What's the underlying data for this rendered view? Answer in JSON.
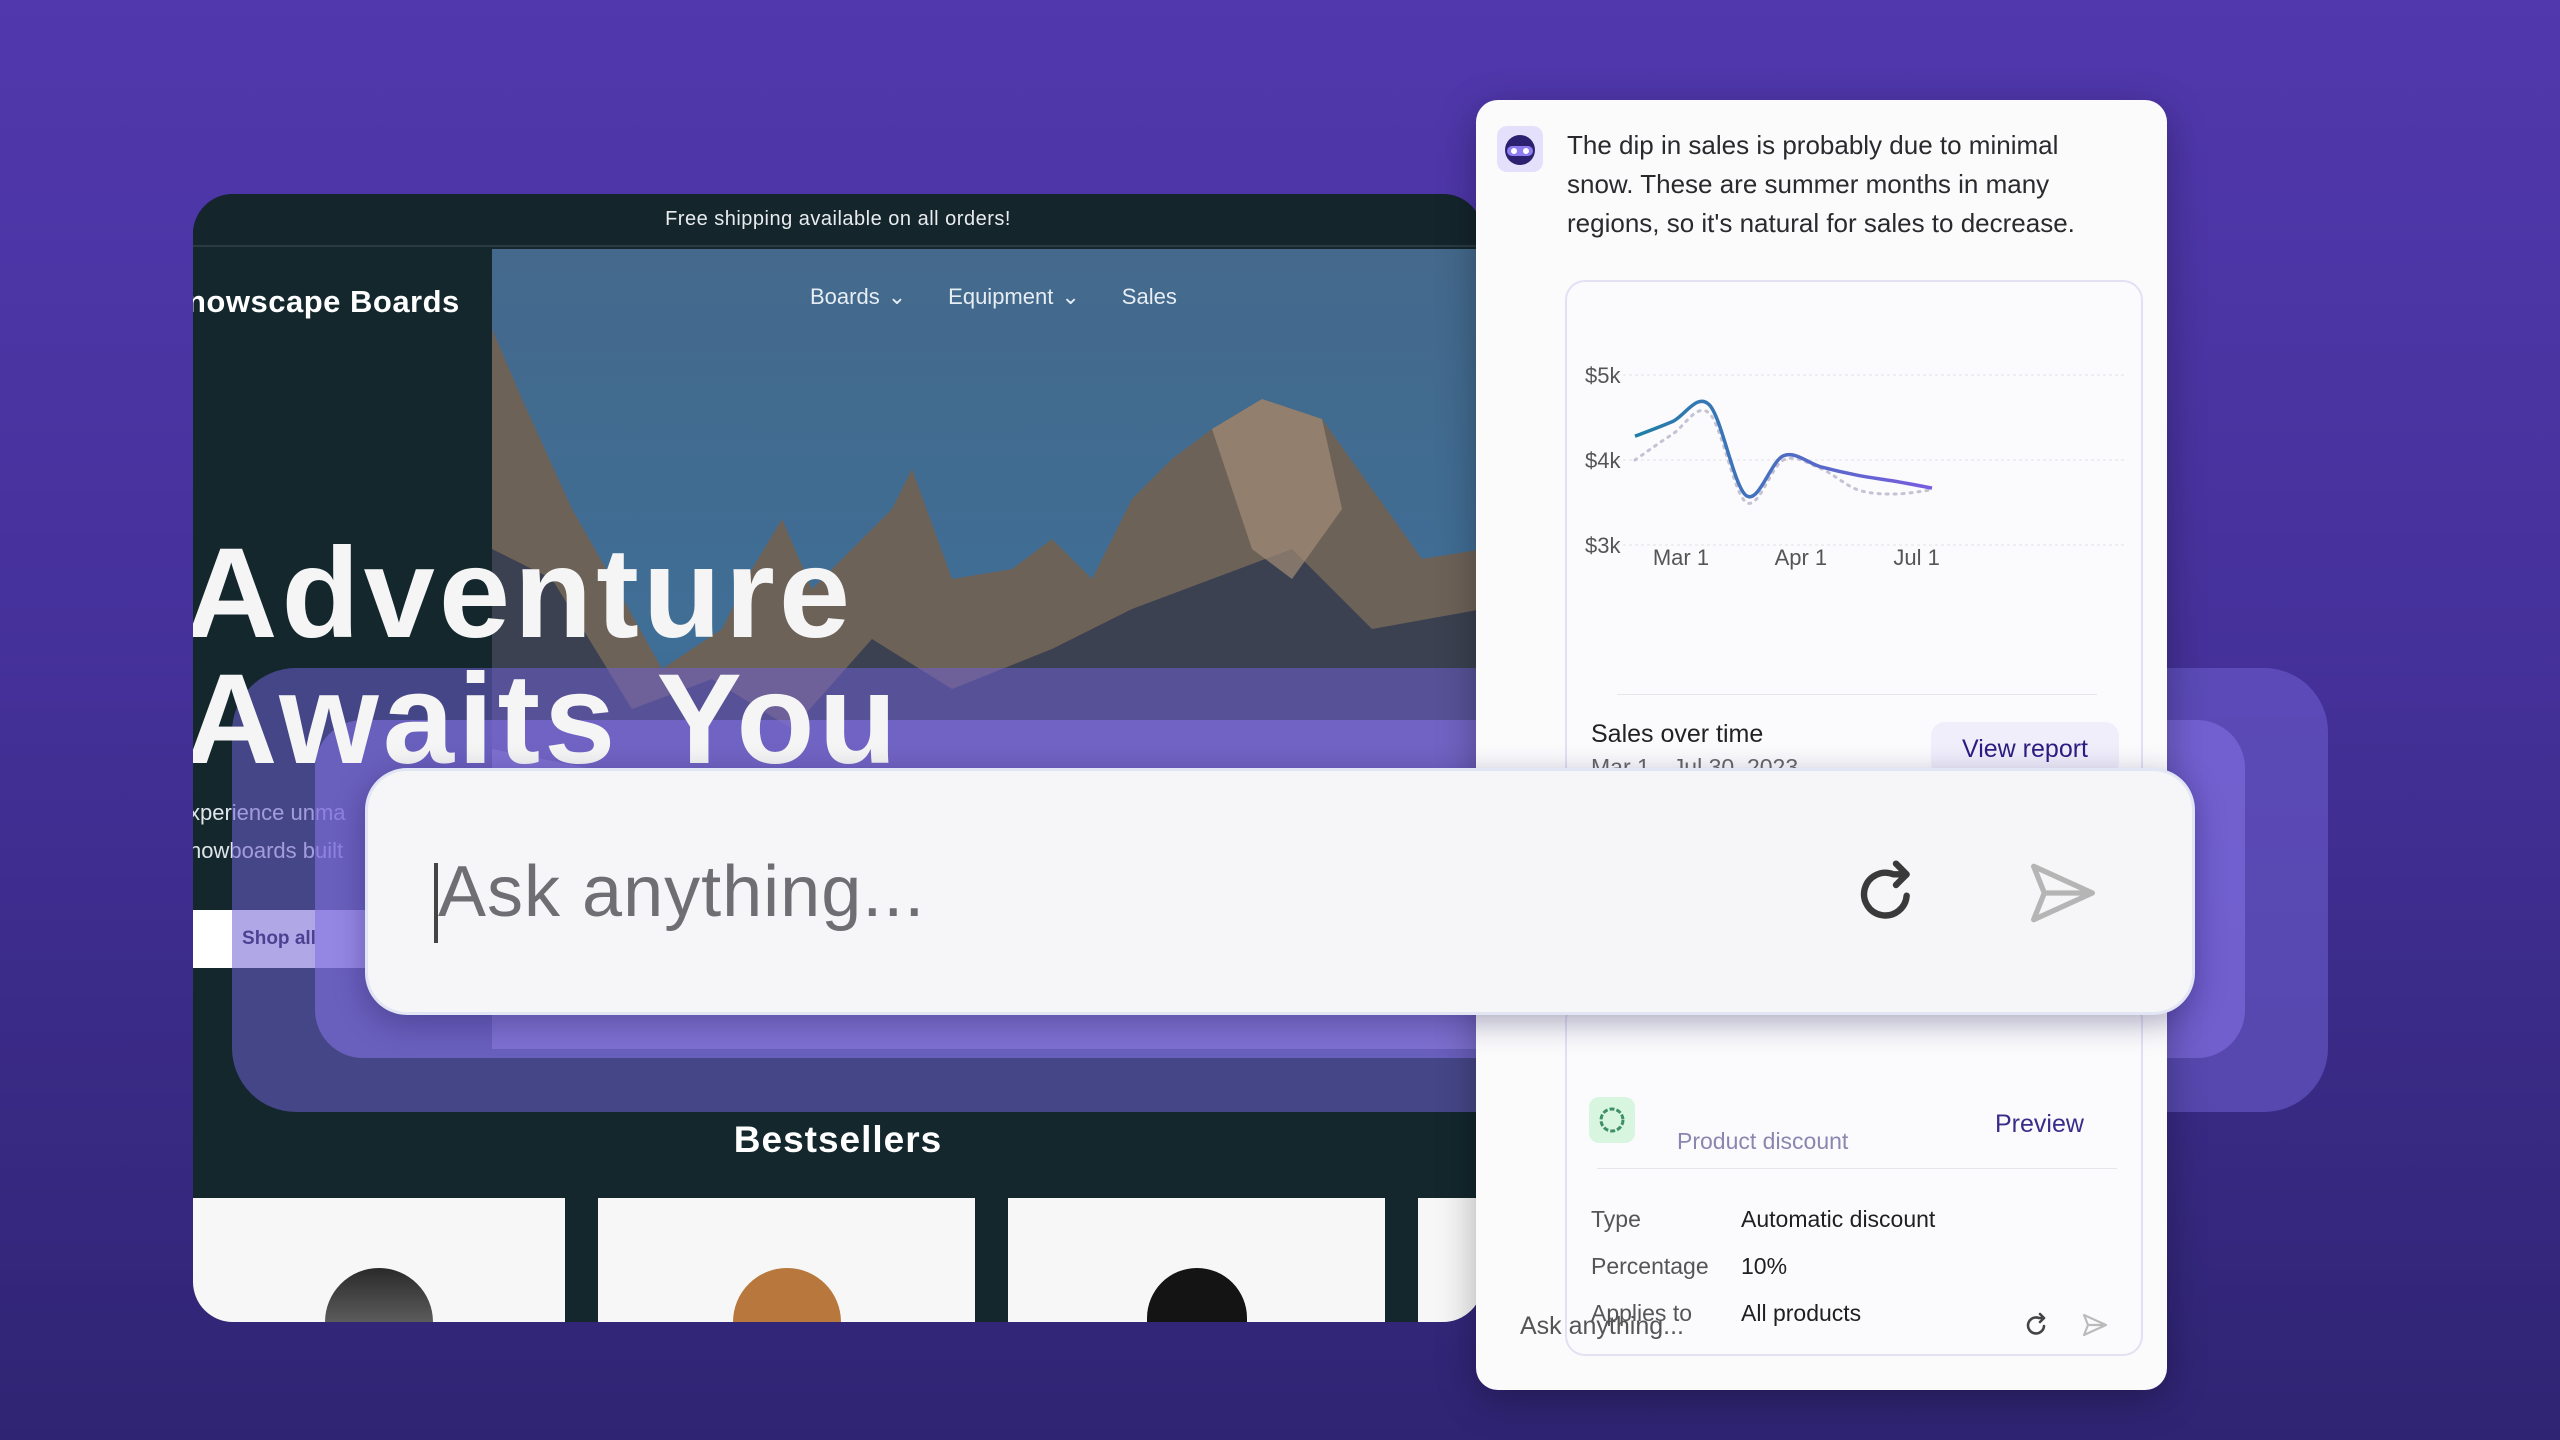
{
  "store": {
    "announcement": "Free shipping available on all orders!",
    "logo": "nowscape Boards",
    "nav": [
      {
        "label": "Boards",
        "icon": "chevron-down-icon"
      },
      {
        "label": "Equipment",
        "icon": "chevron-down-icon"
      },
      {
        "label": "Sales"
      }
    ],
    "headline_line1": "Adventure",
    "headline_line2": "Awaits You",
    "subtext_line1": "xperience unma",
    "subtext_line2": "nowboards built",
    "shop_button": "Shop all",
    "bestsellers_title": "Bestsellers",
    "product_colors": [
      "#4a4a4a",
      "#b8773c",
      "#141414"
    ]
  },
  "big_input": {
    "placeholder": "Ask anything...",
    "refresh_icon": "refresh-icon",
    "send_icon": "send-icon"
  },
  "assistant": {
    "avatar_icon": "robot-avatar-icon",
    "message": "The dip in sales is probably due to minimal snow. These are summer months in many regions, so it's natural for sales to decrease.",
    "chart_card": {
      "title": "Sales over time",
      "date_range": "Mar 1—Jul 30, 2023",
      "button": "View report"
    },
    "discount_card": {
      "icon": "discount-badge-icon",
      "subtitle": "Product discount",
      "preview_link": "Preview",
      "rows": [
        {
          "label": "Type",
          "value": "Automatic discount"
        },
        {
          "label": "Percentage",
          "value": "10%"
        },
        {
          "label": "Applies to",
          "value": "All products"
        }
      ]
    },
    "input_placeholder": "Ask anything..."
  },
  "colors": {
    "accent": "#2c1d82",
    "line_start": "#1f7fa6",
    "line_end": "#7a5ce0",
    "background": "#4a34a8"
  },
  "chart_data": {
    "type": "line",
    "title": "Sales over time",
    "x_ticks": [
      "Mar 1",
      "Apr 1",
      "Jul 1"
    ],
    "y_ticks": [
      "$3k",
      "$4k",
      "$5k"
    ],
    "ylim": [
      3000,
      5000
    ],
    "grid": true,
    "series": [
      {
        "style": "solid",
        "values": [
          4280,
          4450,
          4650,
          3580,
          4050,
          3920,
          3820,
          3750,
          3670
        ]
      },
      {
        "style": "dotted",
        "values": [
          4000,
          4300,
          4550,
          3500,
          4000,
          3900,
          3650,
          3600,
          3650
        ]
      }
    ]
  }
}
